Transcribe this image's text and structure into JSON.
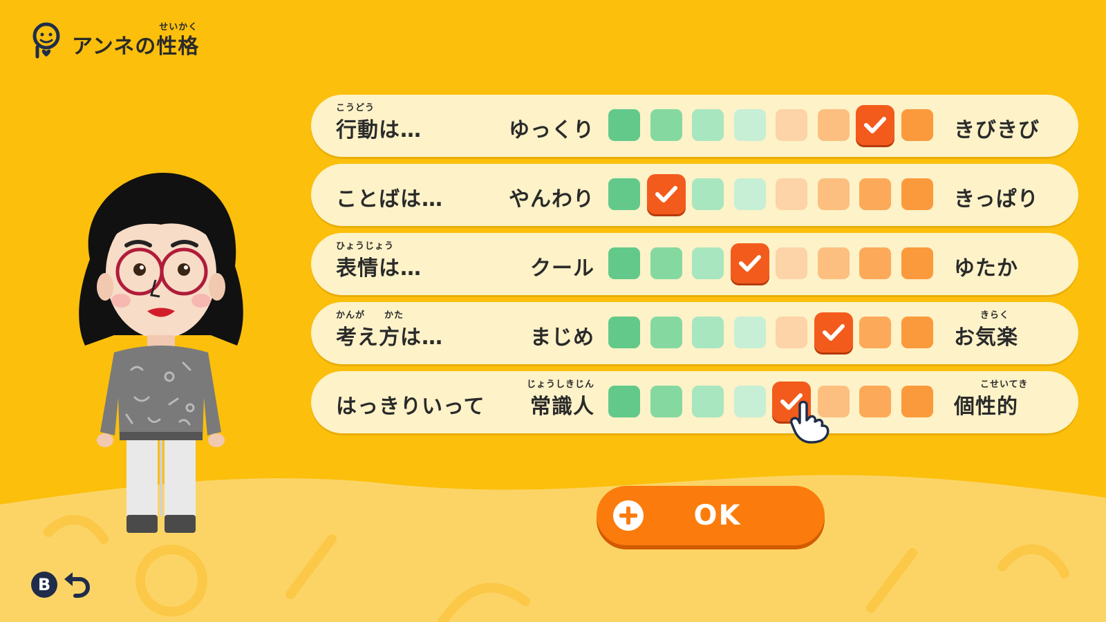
{
  "header": {
    "title": "アンネの性格",
    "title_ruby": "せいかく"
  },
  "traits": [
    {
      "label": "行動は…",
      "label_ruby": "こうどう",
      "left": "ゆっくり",
      "left_ruby": "",
      "right": "きびきび",
      "right_ruby": "",
      "selected_index": 6
    },
    {
      "label": "ことばは…",
      "label_ruby": "",
      "left": "やんわり",
      "left_ruby": "",
      "right": "きっぱり",
      "right_ruby": "",
      "selected_index": 1
    },
    {
      "label": "表情は…",
      "label_ruby": "ひょうじょう",
      "left": "クール",
      "left_ruby": "",
      "right": "ゆたか",
      "right_ruby": "",
      "selected_index": 3
    },
    {
      "label": "考え方は…",
      "label_ruby": "かんが　　かた",
      "left": "まじめ",
      "left_ruby": "",
      "right": "お気楽",
      "right_ruby": "きらく",
      "selected_index": 5
    },
    {
      "label": "はっきりいって",
      "label_ruby": "",
      "left": "常識人",
      "left_ruby": "じょうしきじん",
      "right": "個性的",
      "right_ruby": "こせいてき",
      "selected_index": 4
    }
  ],
  "scale": {
    "steps": 8,
    "colors": [
      "#62c98a",
      "#85d9a0",
      "#a8e6bf",
      "#c6efd6",
      "#fdd3a8",
      "#fcbf80",
      "#fca95a",
      "#fb9a3c"
    ],
    "selected_color": "#f35b1d"
  },
  "ok_button": {
    "label": "OK"
  },
  "back": {
    "button_label": "B"
  }
}
